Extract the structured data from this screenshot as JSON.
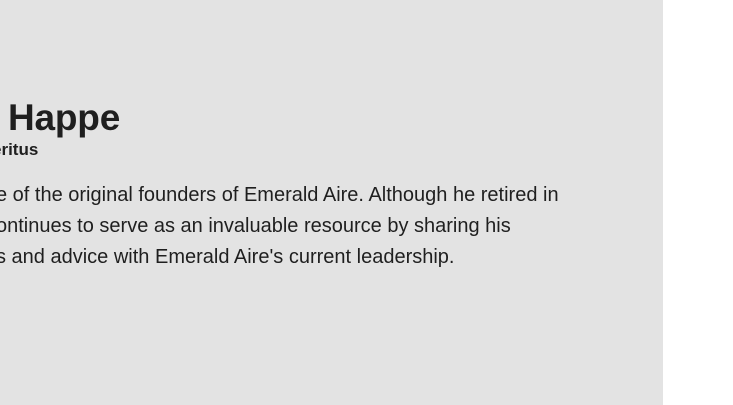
{
  "profile": {
    "name": "Happe",
    "title": "eritus",
    "bio_lines": [
      "e of the original founders of Emerald Aire.  Although he retired in",
      "ontinues to serve as an invaluable resource by sharing his",
      "s and advice with Emerald Aire's current leadership."
    ]
  },
  "colors": {
    "panel_background": "#e3e3e3",
    "page_background": "#ffffff",
    "text": "#1f1f1f"
  }
}
